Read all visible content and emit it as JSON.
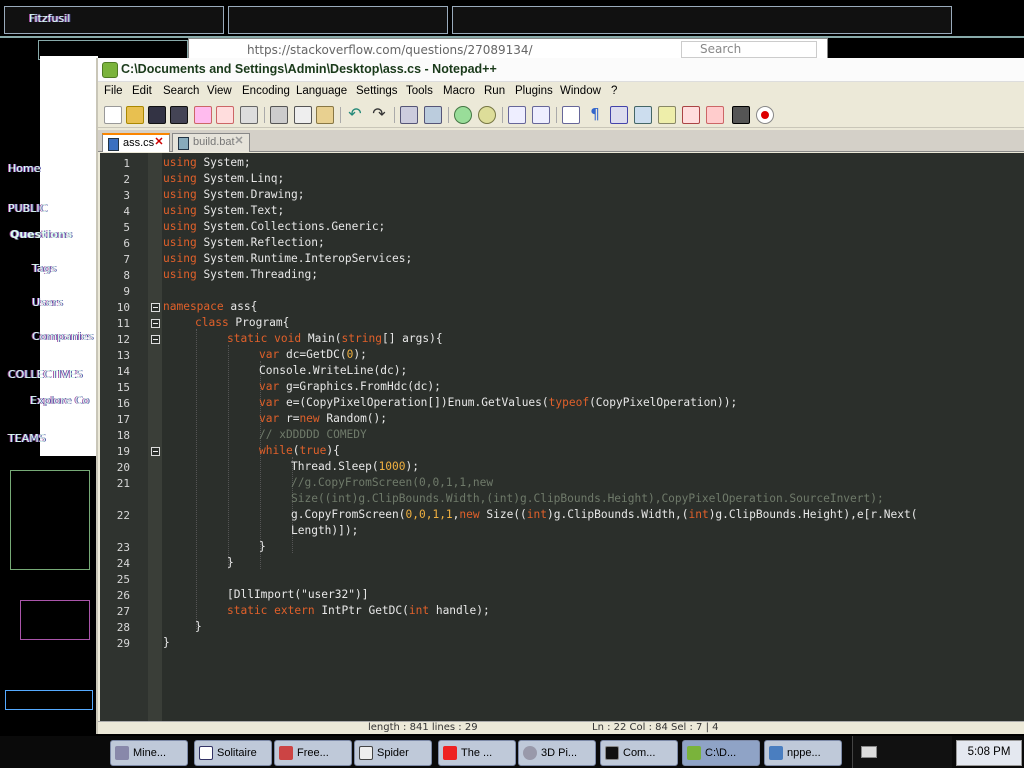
{
  "browser": {
    "tab1": "Fitzfusil",
    "address": "https://stackoverflow.com/questions/27089134/",
    "search_placeholder": "Search"
  },
  "background_labels": [
    "Home",
    "PUBLIC",
    "Questions",
    "Tags",
    "Users",
    "Companies",
    "COLLECTIVES",
    "Explore Co",
    "TEAMS"
  ],
  "npp": {
    "title": "C:\\Documents and Settings\\Admin\\Desktop\\ass.cs - Notepad++",
    "menu": [
      "File",
      "Edit",
      "Search",
      "View",
      "Encoding",
      "Language",
      "Settings",
      "Tools",
      "Macro",
      "Run",
      "Plugins",
      "Window",
      "?"
    ],
    "tabs": [
      {
        "label": "ass.cs",
        "active": true
      },
      {
        "label": "build.bat",
        "active": false
      }
    ],
    "line_numbers": [
      "1",
      "2",
      "3",
      "4",
      "5",
      "6",
      "7",
      "8",
      "9",
      "10",
      "11",
      "12",
      "13",
      "14",
      "15",
      "16",
      "17",
      "18",
      "19",
      "20",
      "21",
      "",
      "22",
      "",
      "23",
      "24",
      "25",
      "26",
      "27",
      "28",
      "29"
    ],
    "status": {
      "length": "length : 841    lines : 29",
      "position": "Ln : 22    Col : 84    Sel : 7 | 4"
    },
    "code": {
      "l1": "System;",
      "l2": "System.Linq;",
      "l3": "System.Drawing;",
      "l4": "System.Text;",
      "l5": "System.Collections.Generic;",
      "l6": "System.Reflection;",
      "l7": "System.Runtime.InteropServices;",
      "l8": "System.Threading;",
      "kw_using": "using",
      "kw_namespace": "namespace",
      "ns_name": " ass{",
      "kw_class": "class",
      "class_name": " Program{",
      "kw_static": "static",
      "kw_void": " void",
      "main_sig_a": " Main(",
      "kw_string": "string",
      "main_sig_b": "[] args){",
      "kw_var": "var",
      "l13": " dc=GetDC(",
      "zero": "0",
      "l13b": ");",
      "l14": "Console.WriteLine(dc);",
      "l15": " g=Graphics.FromHdc(dc);",
      "l16a": " e=(CopyPixelOperation[])Enum.GetValues(",
      "kw_typeof": "typeof",
      "l16b": "(CopyPixelOperation));",
      "l17a": " r=",
      "kw_new": "new",
      "l17b": " Random();",
      "l18": "// xDDDDD COMEDY",
      "kw_while": "while",
      "l19a": "(",
      "kw_true": "true",
      "l19b": "){",
      "l20a": "Thread.Sleep(",
      "n1000": "1000",
      "l20b": ");",
      "l21a": "//g.CopyFromScreen(0,0,1,1,new",
      "l21b": "Size((int)g.ClipBounds.Width,(int)g.ClipBounds.Height),CopyPixelOperation.SourceInvert);",
      "l22a": "g.CopyFromScreen(",
      "l22nums": "0,0,1,1",
      "l22b": ",",
      "l22c": " Size((",
      "kw_int": "int",
      "l22d": ")g.ClipBounds.Width,(",
      "l22e": ")g.ClipBounds.Height),e[r.Next(",
      "l22f": "Length)]);",
      "close_brace": "}",
      "l26": "[DllImport(\"user32\")]",
      "kw_extern": " extern",
      "l27a": " IntPtr GetDC(",
      "l27b": " handle);"
    }
  },
  "taskbar": {
    "items": [
      "Mine...",
      "Solitaire",
      "Free...",
      "Spider",
      "The ...",
      "3D Pi...",
      "Com...",
      "C:\\D...",
      "nppe..."
    ],
    "clock": "5:08 PM"
  },
  "colors": {
    "keyword": "#e0602a",
    "number": "#f0b040",
    "comment": "#6f7a6a",
    "editor_bg": "#2b2f2b"
  }
}
